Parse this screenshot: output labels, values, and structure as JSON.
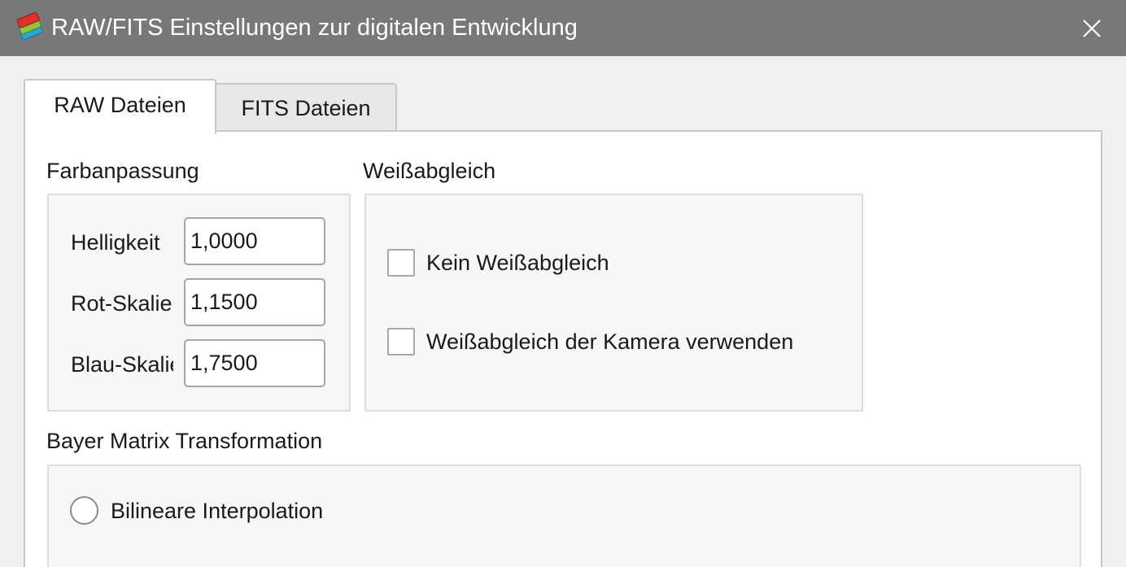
{
  "window": {
    "title": "RAW/FITS Einstellungen zur digitalen Entwicklung",
    "icon": "app-color-filters-icon",
    "close_icon": "close-icon"
  },
  "tabs": [
    {
      "label": "RAW Dateien",
      "selected": true
    },
    {
      "label": "FITS Dateien",
      "selected": false
    }
  ],
  "color_adjustment": {
    "title": "Farbanpassung",
    "fields": [
      {
        "label": "Helligkeit",
        "value": "1,0000"
      },
      {
        "label": "Rot-Skalierung",
        "value": "1,1500"
      },
      {
        "label": "Blau-Skalierung",
        "value": "1,7500"
      }
    ]
  },
  "white_balance": {
    "title": "Weißabgleich",
    "options": [
      {
        "label": "Kein Weißabgleich",
        "checked": false
      },
      {
        "label": "Weißabgleich der Kamera verwenden",
        "checked": false
      }
    ]
  },
  "bayer": {
    "title": "Bayer Matrix Transformation",
    "options": [
      {
        "label": "Bilineare Interpolation",
        "selected": false
      }
    ]
  },
  "colors": {
    "titlebar": "#787878",
    "panel": "#ffffff",
    "groupbox": "#f7f7f7"
  }
}
